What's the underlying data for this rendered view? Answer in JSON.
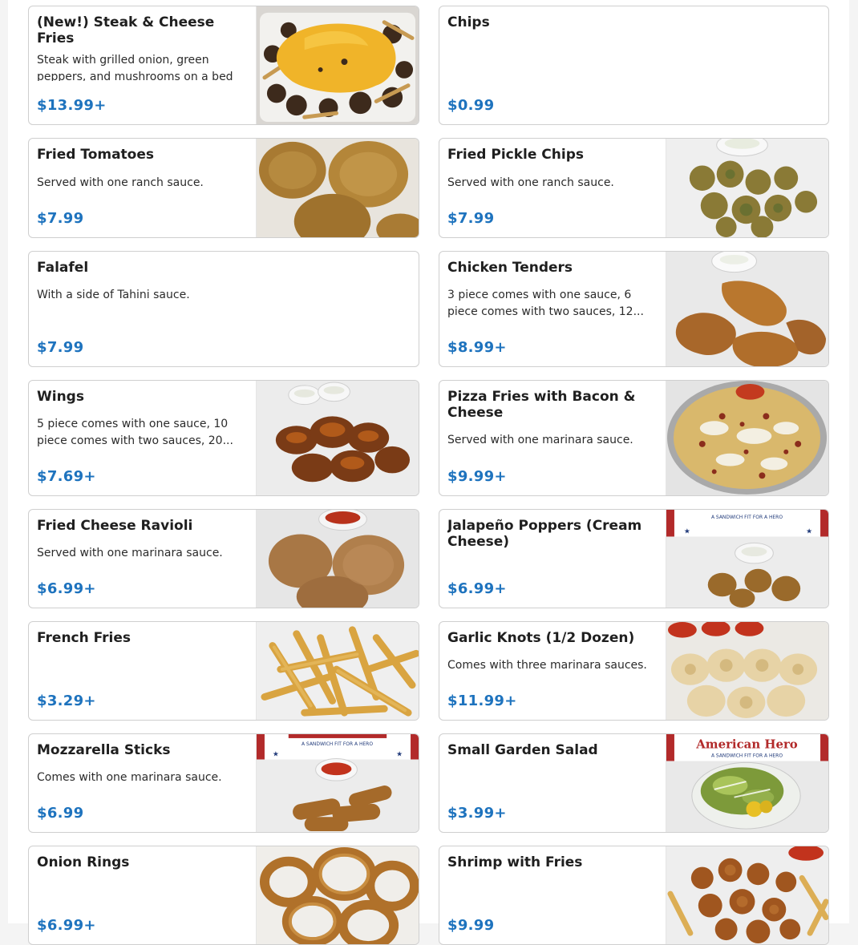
{
  "menu": {
    "items": [
      {
        "name": "(New!) Steak & Cheese Fries",
        "description": "Steak with grilled onion, green peppers, and mushrooms on a bed",
        "price": "$13.99+",
        "image": "steak-cheese-fries-photo"
      },
      {
        "name": "Chips",
        "description": "",
        "price": "$0.99",
        "image": ""
      },
      {
        "name": "Fried Tomatoes",
        "description": "Served with one ranch sauce.",
        "price": "$7.99",
        "image": "fried-tomatoes-photo"
      },
      {
        "name": "Fried Pickle Chips",
        "description": "Served with one ranch sauce.",
        "price": "$7.99",
        "image": "fried-pickle-chips-photo"
      },
      {
        "name": "Falafel",
        "description": "With a side of Tahini sauce.",
        "price": "$7.99",
        "image": ""
      },
      {
        "name": "Chicken Tenders",
        "description": "3 piece comes with one sauce, 6 piece comes with two sauces, 12...",
        "price": "$8.99+",
        "image": "chicken-tenders-photo"
      },
      {
        "name": "Wings",
        "description": "5 piece comes with one sauce, 10 piece comes with two sauces, 20...",
        "price": "$7.69+",
        "image": "wings-photo"
      },
      {
        "name": "Pizza Fries with Bacon & Cheese",
        "description": "Served with one marinara sauce.",
        "price": "$9.99+",
        "image": "pizza-fries-photo"
      },
      {
        "name": "Fried Cheese Ravioli",
        "description": "Served with one marinara sauce.",
        "price": "$6.99+",
        "image": "fried-ravioli-photo"
      },
      {
        "name": "Jalapeño Poppers (Cream Cheese)",
        "description": "",
        "price": "$6.99+",
        "image": "jalapeno-poppers-photo"
      },
      {
        "name": "French Fries",
        "description": "",
        "price": "$3.29+",
        "image": "french-fries-photo"
      },
      {
        "name": "Garlic Knots (1/2 Dozen)",
        "description": "Comes with three marinara sauces.",
        "price": "$11.99+",
        "image": "garlic-knots-photo"
      },
      {
        "name": "Mozzarella Sticks",
        "description": "Comes with one marinara sauce.",
        "price": "$6.99",
        "image": "mozzarella-sticks-photo"
      },
      {
        "name": "Small Garden Salad",
        "description": "",
        "price": "$3.99+",
        "image": "garden-salad-photo"
      },
      {
        "name": "Onion Rings",
        "description": "",
        "price": "$6.99+",
        "image": "onion-rings-photo"
      },
      {
        "name": "Shrimp with Fries",
        "description": "",
        "price": "$9.99",
        "image": "shrimp-fries-photo"
      }
    ],
    "image_text": {
      "banner_brand": "American Hero",
      "banner_tagline": "A SANDWICH FIT FOR A HERO"
    }
  }
}
